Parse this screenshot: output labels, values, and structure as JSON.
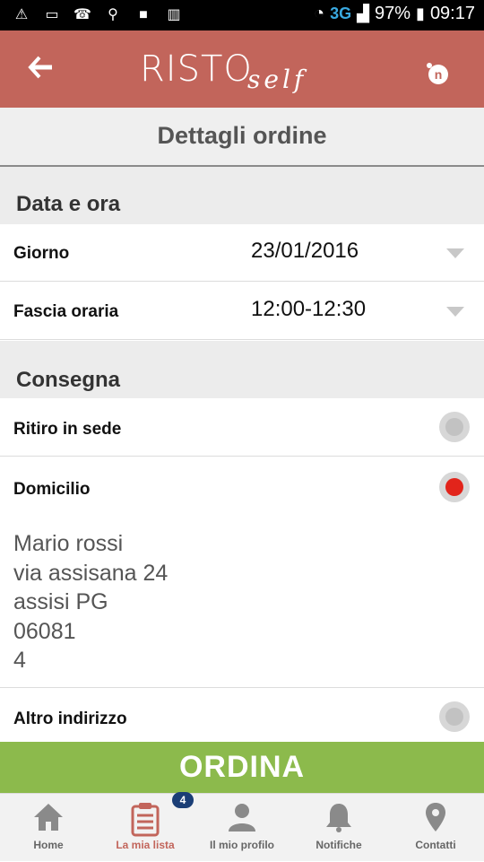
{
  "status_bar": {
    "network": "3G",
    "battery_pct": "97%",
    "time": "09:17"
  },
  "app_bar": {
    "logo_main": "RISTO",
    "logo_script": "self",
    "notification_label": "n"
  },
  "page": {
    "title": "Dettagli ordine"
  },
  "sections": {
    "date_time": {
      "title": "Data e ora",
      "day_label": "Giorno",
      "day_value": "23/01/2016",
      "slot_label": "Fascia oraria",
      "slot_value": "12:00-12:30"
    },
    "delivery": {
      "title": "Consegna",
      "pickup_label": "Ritiro in sede",
      "home_label": "Domicilio",
      "other_label": "Altro indirizzo",
      "selected": "Domicilio",
      "address": {
        "name": "Mario rossi",
        "street": "via assisana 24",
        "city": "assisi PG",
        "zip": "06081",
        "extra": "4"
      }
    }
  },
  "order_button": {
    "label": "ORDINA"
  },
  "tabbar": {
    "badge": "4",
    "items": [
      {
        "label": "Home",
        "icon": "home-icon"
      },
      {
        "label": "La mia lista",
        "icon": "clipboard-icon"
      },
      {
        "label": "Il mio profilo",
        "icon": "user-icon"
      },
      {
        "label": "Notifiche",
        "icon": "bell-icon"
      },
      {
        "label": "Contatti",
        "icon": "map-pin-icon"
      }
    ],
    "active_color": "#c2655b",
    "inactive_color": "#777777"
  },
  "colors": {
    "brand": "#c2655b",
    "order_green": "#8cba4c",
    "radio_selected": "#e2241b",
    "badge": "#1b3e76"
  }
}
